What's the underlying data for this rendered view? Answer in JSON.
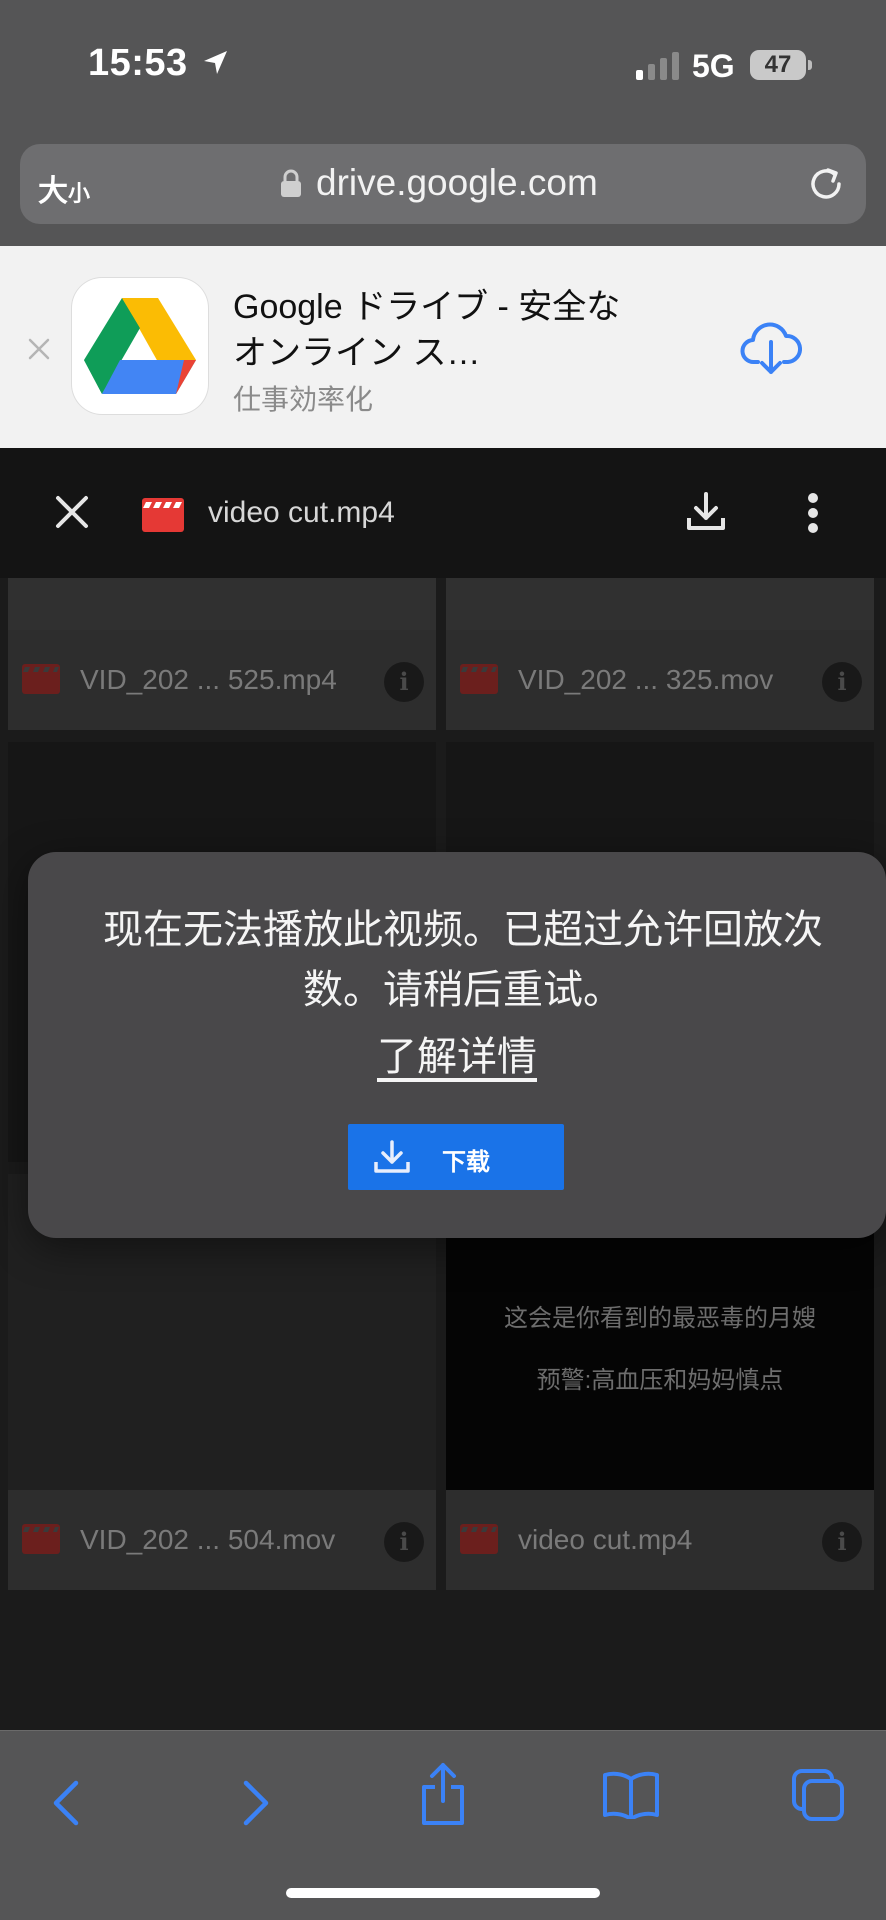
{
  "status": {
    "time": "15:53",
    "network": "5G",
    "battery": "47"
  },
  "browser": {
    "text_size_label_big": "大",
    "text_size_label_small": "小",
    "url": "drive.google.com"
  },
  "app_banner": {
    "title": "Google ドライブ - 安全なオンライン ス…",
    "category": "仕事効率化"
  },
  "viewer": {
    "file_name": "video cut.mp4",
    "files": [
      {
        "name": "VID_202 ... 525.mp4"
      },
      {
        "name": "VID_202 ... 325.mov"
      },
      {
        "name": "VID_202 ... 504.mov"
      },
      {
        "name": "video cut.mp4"
      }
    ],
    "thumb_caption_line1": "这会是你看到的最恶毒的月嫂",
    "thumb_caption_line2": "预警:高血压和妈妈慎点"
  },
  "modal": {
    "message": "现在无法播放此视频。已超过允许回放次数。请稍后重试。",
    "learn_more": "了解详情",
    "download_label": "下载"
  },
  "colors": {
    "accent_blue": "#1a73e8",
    "safari_blue": "#3b82f6"
  }
}
